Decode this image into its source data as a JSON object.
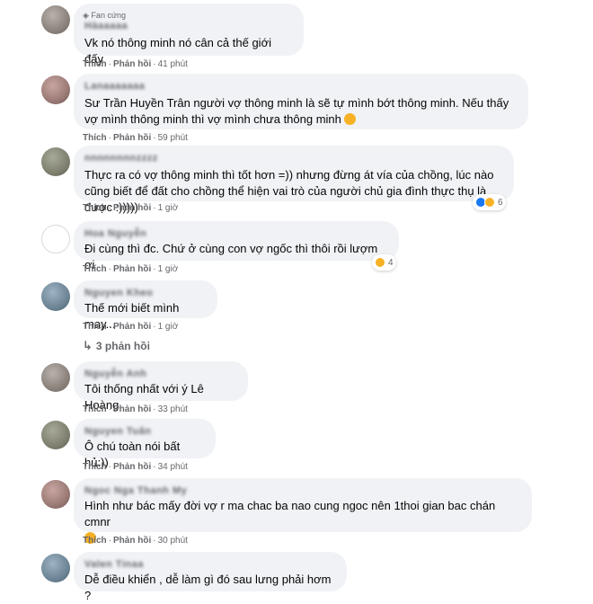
{
  "colors": {
    "bubble": "#f0f2f5",
    "meta": "#65676b",
    "text": "#050505",
    "like": "#1877f2",
    "haha": "#f7b125"
  },
  "comments": [
    {
      "name": "Hàaaaaa",
      "badge": "Fan cứng",
      "text": "Vk nó thông minh nó cân cả thế giới đấy",
      "like": "Thích",
      "reply": "Phản hồi",
      "time": "41 phút"
    },
    {
      "name": "Lanaaaaaaa",
      "text": "Sư Trần Huyền Trân người vợ thông minh là sẽ tự mình bớt thông minh. Nếu thấy vợ mình thông minh thì vợ mình chưa thông minh",
      "emoji": "smile-emoji",
      "like": "Thích",
      "reply": "Phản hồi",
      "time": "59 phút"
    },
    {
      "name": "nnnnnnnnzzzz",
      "text": "Thực ra có vợ thông minh thì tốt hơn =)) nhưng đừng át vía của chồng, lúc nào cũng biết để đất cho chồng thể hiện vai trò của người chủ gia đình thực thụ là được :)))))",
      "like": "Thích",
      "reply": "Phản hồi",
      "time": "1 giờ",
      "reactions": {
        "icons": [
          "like-reaction-icon",
          "haha-reaction-icon"
        ],
        "count": "6"
      }
    },
    {
      "name": "Hoa Nguyễn",
      "text": "Đi cùng thì đc. Chứ ở cùng con vợ ngốc thì thôi rồi lượm ơi",
      "like": "Thích",
      "reply": "Phản hồi",
      "time": "1 giờ",
      "reactions": {
        "icons": [
          "haha-reaction-icon"
        ],
        "count": "4"
      }
    },
    {
      "name": "Nguyen Kheo",
      "text": "Thế mới biết mình may...",
      "like": "Thích",
      "reply": "Phản hồi",
      "time": "1 giờ",
      "replies_label": "3 phản hồi"
    },
    {
      "name": "Nguyễn Anh",
      "text": "Tôi thống nhất với ý Lê Hoàng",
      "like": "Thích",
      "reply": "Phản hồi",
      "time": "33 phút"
    },
    {
      "name": "Nguyen Tuấn",
      "text": "Ô chú toàn nói bất hủ:))",
      "like": "Thích",
      "reply": "Phản hồi",
      "time": "34 phút"
    },
    {
      "name": "Ngoc Nga Thanh My",
      "text": "Hình như bác mấy đời vợ r ma chac ba nao cung ngoc nên 1thoi gian bac chán cmnr",
      "emoji": "grin-emoji",
      "like": "Thích",
      "reply": "Phản hồi",
      "time": "30 phút"
    },
    {
      "name": "Valen Tinaa",
      "text": "Dễ điều khiển , dễ làm gì đó sau lưng phải hơm ?"
    }
  ]
}
